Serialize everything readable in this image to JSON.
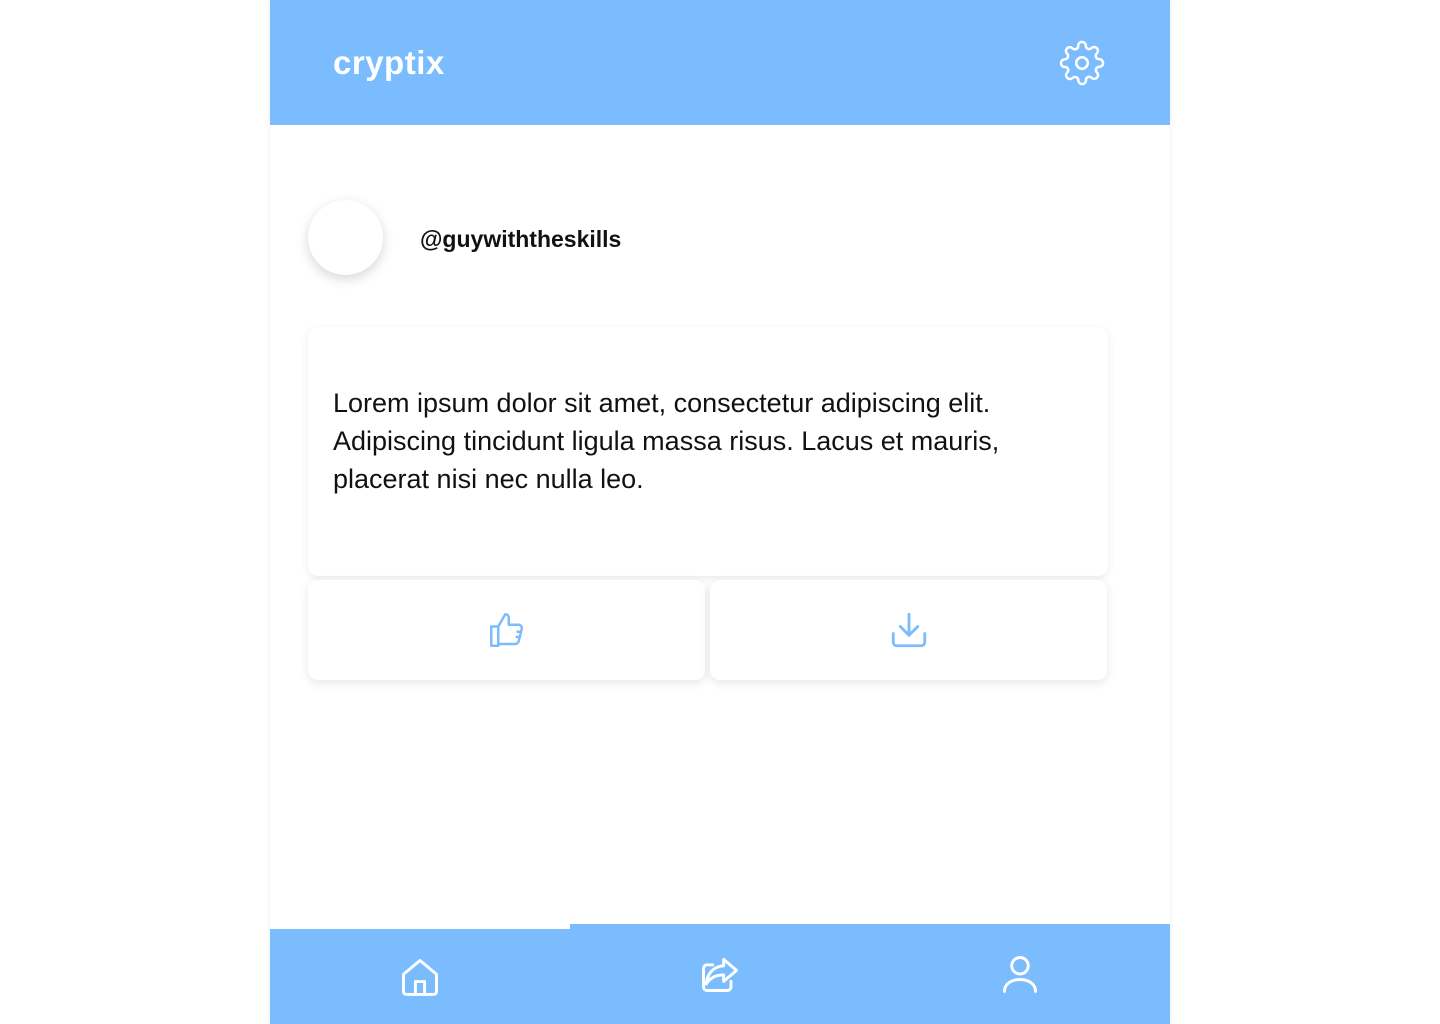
{
  "header": {
    "brand": "cryptix",
    "settings_icon": "gear-icon"
  },
  "profile": {
    "username": "@guywiththeskills"
  },
  "post": {
    "text": "Lorem ipsum dolor sit amet, consectetur adipiscing elit. Adipiscing tincidunt ligula massa risus. Lacus et mauris, placerat nisi nec nulla leo."
  },
  "actions": {
    "like_icon": "thumbs-up-icon",
    "download_icon": "download-icon",
    "icon_color": "#7bbcff"
  },
  "bottom_nav": {
    "items": [
      {
        "icon": "home-icon"
      },
      {
        "icon": "share-icon"
      },
      {
        "icon": "user-icon"
      }
    ]
  },
  "colors": {
    "accent": "#7bbcff",
    "background": "#ffffff",
    "text": "#111111"
  }
}
